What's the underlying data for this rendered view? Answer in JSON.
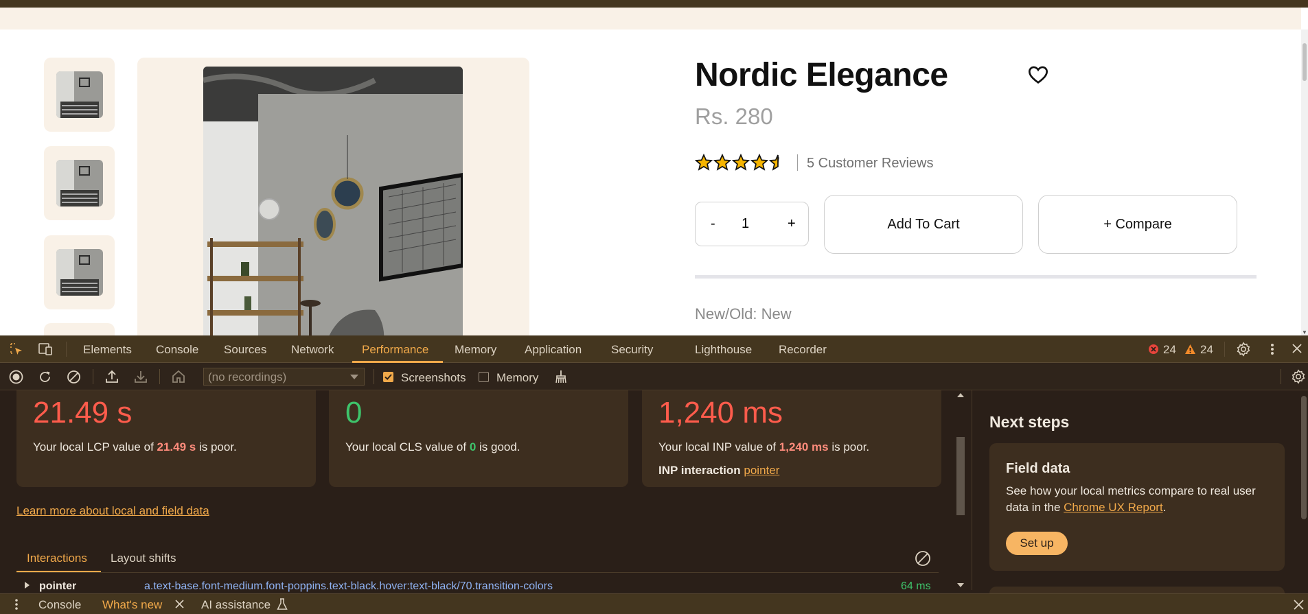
{
  "product": {
    "title": "Nordic Elegance",
    "price": "Rs. 280",
    "rating": 4.5,
    "rating_max": 5,
    "reviews_text": "5 Customer Reviews",
    "quantity": {
      "minus": "-",
      "value": "1",
      "plus": "+"
    },
    "add_to_cart": "Add To Cart",
    "compare": "+ Compare",
    "new_old": "New/Old: New"
  },
  "devtools": {
    "tabs": [
      "Elements",
      "Console",
      "Sources",
      "Network",
      "Performance",
      "Memory",
      "Application",
      "Security",
      "Lighthouse",
      "Recorder"
    ],
    "active_tab": "Performance",
    "error_count": "24",
    "warning_count": "24",
    "toolbar": {
      "recordings_placeholder": "(no recordings)",
      "screenshots_label": "Screenshots",
      "screenshots_checked": true,
      "memory_label": "Memory",
      "memory_checked": false
    },
    "metrics": {
      "lcp": {
        "value": "21.49 s",
        "desc_prefix": "Your local LCP value of ",
        "desc_value": "21.49 s",
        "desc_suffix": " is poor."
      },
      "cls": {
        "value": "0",
        "desc_prefix": "Your local CLS value of ",
        "desc_value": "0",
        "desc_suffix": " is good."
      },
      "inp": {
        "value": "1,240 ms",
        "desc_prefix": "Your local INP value of ",
        "desc_value": "1,240 ms",
        "desc_suffix": " is poor.",
        "interaction_label": "INP interaction",
        "interaction_link": "pointer"
      }
    },
    "learn_more": "Learn more about local and field data",
    "subtabs": [
      "Interactions",
      "Layout shifts"
    ],
    "interaction_row": {
      "type": "pointer",
      "selector": "a.text-base.font-medium.font-poppins.text-black.hover:text-black/70.transition-colors",
      "duration": "64 ms"
    },
    "next_steps": {
      "title": "Next steps",
      "field_data_title": "Field data",
      "field_data_desc": "See how your local metrics compare to real user data in the ",
      "field_data_link": "Chrome UX Report",
      "field_data_end": ".",
      "setup_label": "Set up"
    },
    "drawer": {
      "tabs": [
        "Console",
        "What's new",
        "AI assistance"
      ],
      "active": "What's new"
    }
  },
  "colors": {
    "accent": "#f1a94a",
    "poor": "#ff5c4c",
    "good": "#3ec46b",
    "cream": "#f9f1e7",
    "devtools_bg": "#2a1f18",
    "star": "#f5b400"
  },
  "icons": [
    "heart-icon",
    "star-icon",
    "inspect-icon",
    "device-toolbar-icon",
    "error-icon",
    "warning-icon",
    "settings-icon",
    "kebab-menu-icon",
    "close-icon",
    "record-icon",
    "reload-icon",
    "clear-icon",
    "upload-icon",
    "download-icon",
    "home-icon",
    "broom-icon"
  ]
}
